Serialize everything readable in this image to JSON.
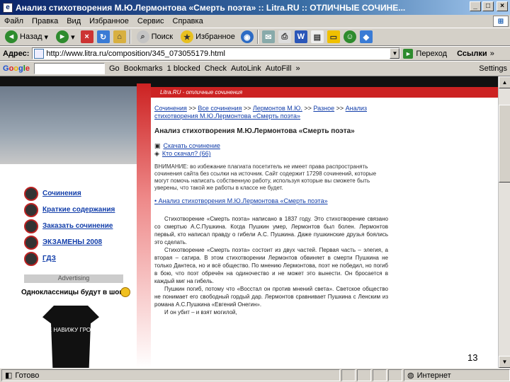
{
  "window": {
    "title": "Анализ стихотворения М.Ю.Лермонтова «Смерть поэта» :: Litra.RU :: ОТЛИЧНЫЕ СОЧИНЕ..."
  },
  "menu": {
    "items": [
      "Файл",
      "Правка",
      "Вид",
      "Избранное",
      "Сервис",
      "Справка"
    ]
  },
  "toolbar": {
    "back_label": "Назад",
    "search_label": "Поиск",
    "favorites_label": "Избранное"
  },
  "address": {
    "label": "Адрес:",
    "url": "http://www.litra.ru/composition/345_073055179.html",
    "go_label": "Переход",
    "links_label": "Ссылки"
  },
  "google_bar": {
    "logo": "Google",
    "go_label": "Go",
    "bookmarks_label": "Bookmarks",
    "blocked_label": "1 blocked",
    "check_label": "Check",
    "autolink_label": "AutoLink",
    "autofill_label": "AutoFill",
    "settings_label": "Settings"
  },
  "site": {
    "header_text": "Litra.RU - отличные сочинения",
    "nav": [
      "Сочинения",
      "Краткие содержания",
      "Заказать сочинение",
      "ЭКЗАМЕНЫ 2008",
      "ГДЗ"
    ],
    "adv": "Advertising",
    "social": "Одноклассницы будут в шоке",
    "tshirt_text": "НЕ НАВИЖУ ГРОЗУ"
  },
  "content": {
    "breadcrumb": [
      "Сочинения",
      "Все сочинения",
      "Лермонтов М.Ю.",
      "Разное",
      "Анализ стихотворения М.Ю.Лермонтова «Смерть поэта»"
    ],
    "heading": "Анализ стихотворения М.Ю.Лермонтова «Смерть поэта»",
    "download": "Скачать сочинение",
    "size": "Кто скачал? (66)",
    "notice": "ВНИМАНИЕ: во избежание плагиата посетитель не имеет права распространять сочинения сайта без ссылки на источник. Сайт содержит 17298 сочинений, которые могут помочь написать собственную работу, используя которые вы сможете быть уверены, что такой же работы в классе не будет.",
    "link": "Анализ стихотворения М.Ю.Лермонтова «Смерть поэта»",
    "essay": [
      "Стихотворение «Смерть поэта» написано в 1837 году. Это стихотворение связано со смертью А.С.Пушкина. Когда Пушкин умер, Лермонтов был болен. Лермонтов первый, кто написал правду о гибели А.С. Пушкина. Даже пушкинские друзья боялись это сделать.",
      "Стихотворение «Смерть поэта» состоит из двух частей. Первая часть – элегия, а вторая – сатира. В этом стихотворении Лермонтов обвиняет в смерти Пушкина не только Дантеса, но и всё общество. По мнению Лермонтова, поэт не победил, но погиб в бою, что поэт обречён на одиночество и не может это вынести. Он бросается в каждый миг на гибель.",
      "Пушкин погиб, потому что «Восстал он против мнений света». Светское общество не понимает его свободный гордый дар. Лермонтов сравнивает Пушкина с Ленским из романа А.С.Пушкина «Евгений Онегин».",
      "И он убит – и взят могилой,"
    ]
  },
  "slide_number": "13",
  "status": {
    "text": "Готово",
    "zone": "Интернет"
  }
}
